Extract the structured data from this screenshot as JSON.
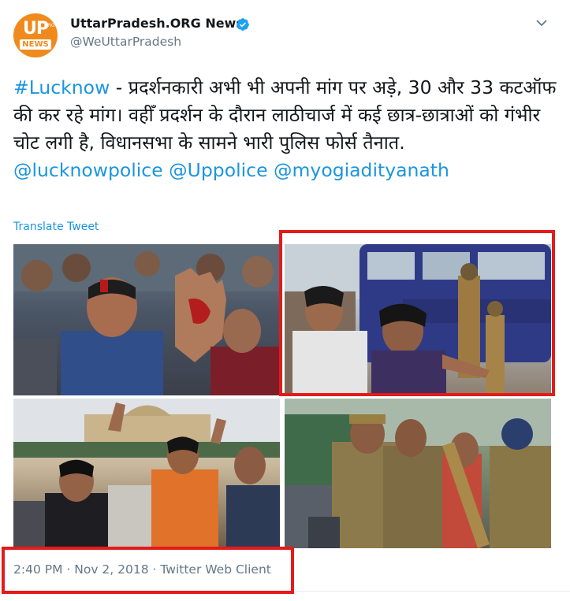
{
  "author": {
    "name": "UttarPradesh.ORG News",
    "handle": "@WeUttarPradesh",
    "avatar_text": "UP",
    "avatar_org": "ORG",
    "avatar_news": "NEWS"
  },
  "tweet": {
    "hashtag": "#Lucknow",
    "body": " - प्रदर्शनकारी अभी भी अपनी मांग पर अड़े, 30 और 33  कटऑफ की कर रहे मांग। वहीँ प्रदर्शन के दौरान लाठीचार्ज में कई छात्र-छात्राओं को गंभीर चोट लगी है, विधानसभा के सामने भारी पुलिस फोर्स तैनात. ",
    "mentions": [
      "@lucknowpolice",
      "@Uppolice",
      "@myogiadityanath"
    ]
  },
  "translate_label": "Translate Tweet",
  "meta": {
    "time": "2:40 PM",
    "date": "Nov 2, 2018",
    "client": "Twitter Web Client",
    "separator": " · "
  },
  "colors": {
    "link": "#1b95e0",
    "secondary_text": "#657786",
    "highlight": "#e31b1b",
    "avatar_bg": "#f08a1c"
  },
  "icons": [
    "verified-badge-icon",
    "chevron-down-icon"
  ]
}
